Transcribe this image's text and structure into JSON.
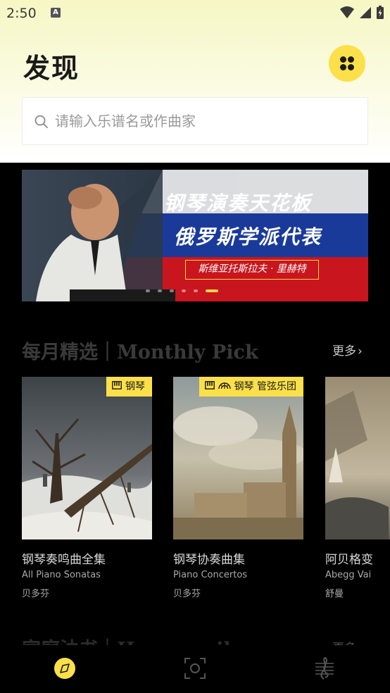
{
  "status": {
    "time": "2:50",
    "notification_icon": "a-letter-icon",
    "icons": [
      "wifi-icon",
      "cell-signal-icon",
      "battery-charging-icon"
    ]
  },
  "header": {
    "title": "发现",
    "menu_icon": "grid-icon"
  },
  "search": {
    "placeholder": "请输入乐谱名或作曲家"
  },
  "banner": {
    "line1": "钢琴演奏天花板",
    "line2": "俄罗斯学派代表",
    "tag": "斯维亚托斯拉夫 · 里赫特",
    "page_count": 6,
    "active_page": 6
  },
  "monthly": {
    "title": "每月精选｜Monthly Pick",
    "more": "更多",
    "cards": [
      {
        "badge": "钢琴",
        "badge_icons": [
          "piano-icon"
        ],
        "title": "钢琴奏鸣曲全集",
        "subtitle": "All Piano Sonatas",
        "composer": "贝多芬"
      },
      {
        "badge": "钢琴 管弦乐团",
        "badge_icons": [
          "piano-icon",
          "orchestra-icon"
        ],
        "title": "钢琴协奏曲集",
        "subtitle": "Piano Concertos",
        "composer": "贝多芬"
      },
      {
        "badge": "",
        "badge_icons": [],
        "title": "阿贝格变",
        "subtitle": "Abegg Vai",
        "composer": "舒曼"
      }
    ]
  },
  "household": {
    "title": "家庭油书｜Hausmusik",
    "more": "更多"
  },
  "bottom_nav": {
    "items": [
      "compass-icon",
      "scan-icon",
      "sheet-music-icon"
    ],
    "active": "compass-icon"
  },
  "colors": {
    "accent": "#fbe04a",
    "background": "#000000",
    "header_gradient_top": "#f6f7c4"
  }
}
